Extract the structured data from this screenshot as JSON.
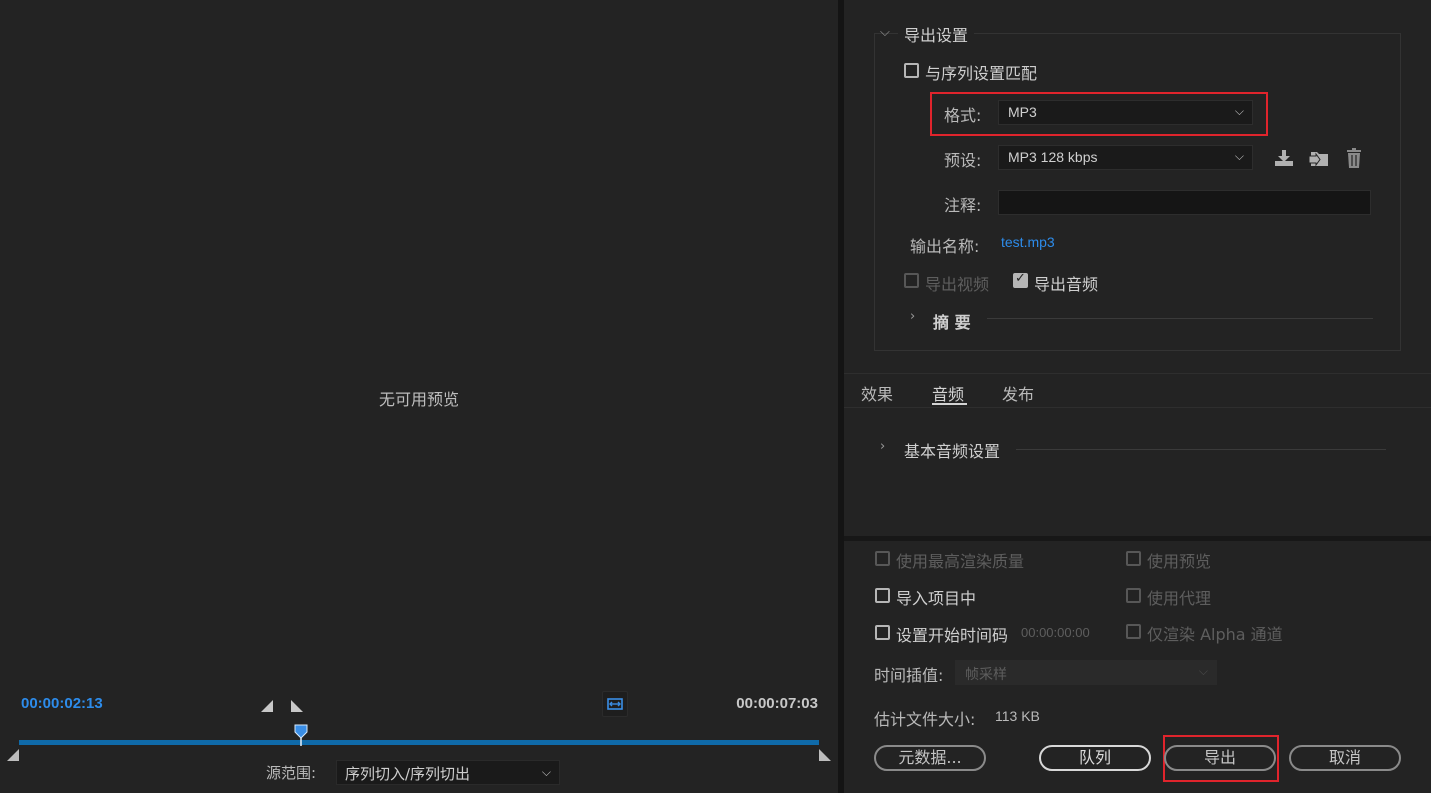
{
  "preview": {
    "no_preview_text": "无可用预览",
    "current_timecode": "00:00:02:13",
    "duration_timecode": "00:00:07:03",
    "playhead_fraction": 0.353,
    "source_range_label": "源范围:",
    "source_range_value": "序列切入/序列切出"
  },
  "export_settings": {
    "section_title": "导出设置",
    "match_sequence_label": "与序列设置匹配",
    "format_label": "格式:",
    "format_value": "MP3",
    "preset_label": "预设:",
    "preset_value": "MP3 128 kbps",
    "comment_label": "注释:",
    "comment_value": "",
    "output_name_label": "输出名称:",
    "output_name_value": "test.mp3",
    "export_video_label": "导出视频",
    "export_audio_label": "导出音频",
    "summary_label": "摘 要"
  },
  "tabs": [
    {
      "label": "效果",
      "active": false
    },
    {
      "label": "音频",
      "active": true
    },
    {
      "label": "发布",
      "active": false
    }
  ],
  "audio": {
    "basic_audio_settings_label": "基本音频设置"
  },
  "options": {
    "max_render_quality": "使用最高渲染质量",
    "use_previews": "使用预览",
    "import_into_project": "导入项目中",
    "use_proxies": "使用代理",
    "set_start_timecode": "设置开始时间码",
    "start_timecode_value": "00:00:00:00",
    "render_alpha_only": "仅渲染 Alpha 通道",
    "time_interpolation_label": "时间插值:",
    "time_interpolation_value": "帧采样",
    "estimated_size_label": "估计文件大小:",
    "estimated_size_value": "113 KB"
  },
  "buttons": {
    "metadata": "元数据...",
    "queue": "队列",
    "export": "导出",
    "cancel": "取消"
  },
  "colors": {
    "accent_blue": "#2d8ceb",
    "highlight_red": "#e0242c",
    "panel_bg": "#232323"
  }
}
